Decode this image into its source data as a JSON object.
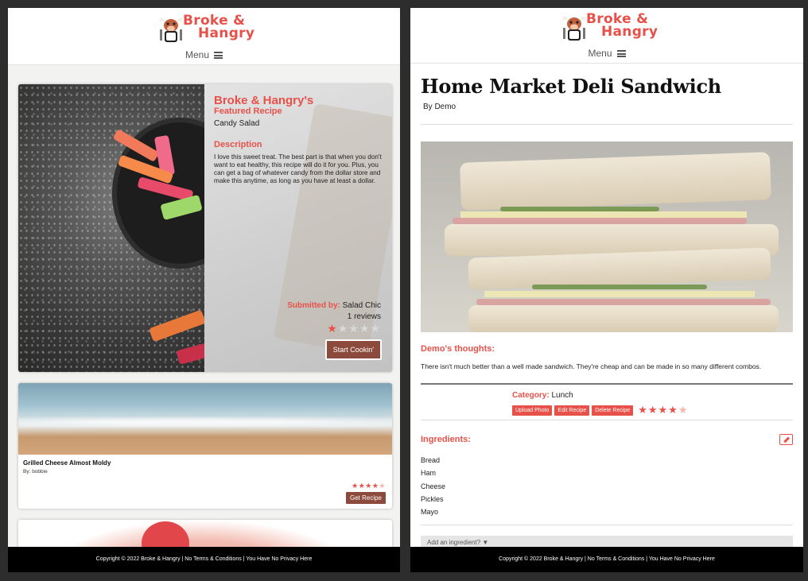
{
  "brand": {
    "logo_line1": "Broke &",
    "logo_line2": "Hangry",
    "menu_label": "Menu"
  },
  "footer": {
    "text": "Copyright © 2022 Broke & Hangry | No Terms & Conditions | You Have No Privacy Here"
  },
  "featured": {
    "brand": "Broke & Hangry's",
    "subtitle": "Featured Recipe",
    "name": "Candy Salad",
    "description_heading": "Description",
    "description": "I love this sweet treat. The best part is that when you don't want to eat healthy, this recipe will do it for you. Plus, you can get a bag of whatever candy from the dollar store and make this anytime, as long as you have at least a dollar.",
    "submitted_label": "Submitted by:",
    "submitted_by": "Salad Chic",
    "reviews": "1 reviews",
    "rating": 1,
    "rating_max": 5,
    "button": "Start Cookin'"
  },
  "cards": [
    {
      "title": "Grilled Cheese Almost Moldy",
      "by": "By: bobbie",
      "rating": 4,
      "rating_max": 5,
      "button": "Get Recipe"
    }
  ],
  "recipe": {
    "title": "Home Market Deli Sandwich",
    "author": "By Demo",
    "thoughts_heading": "Demo's thoughts:",
    "thoughts": "There isn't much better than a well made sandwich. They're cheap and can be made in so many different combos.",
    "category_label": "Category:",
    "category": "Lunch",
    "actions": [
      "Upload Photo",
      "Edit Recipe",
      "Delete Recipe"
    ],
    "rating": 4,
    "rating_max": 5,
    "ingredients_heading": "Ingredients:",
    "ingredients": [
      "Bread",
      "Ham",
      "Cheese",
      "Pickles",
      "Mayo"
    ],
    "add_ingredient": "Add an ingredient? ▼"
  },
  "colors": {
    "accent": "#e8514a",
    "button_brown": "#8b4a3c",
    "footer": "#000000"
  }
}
